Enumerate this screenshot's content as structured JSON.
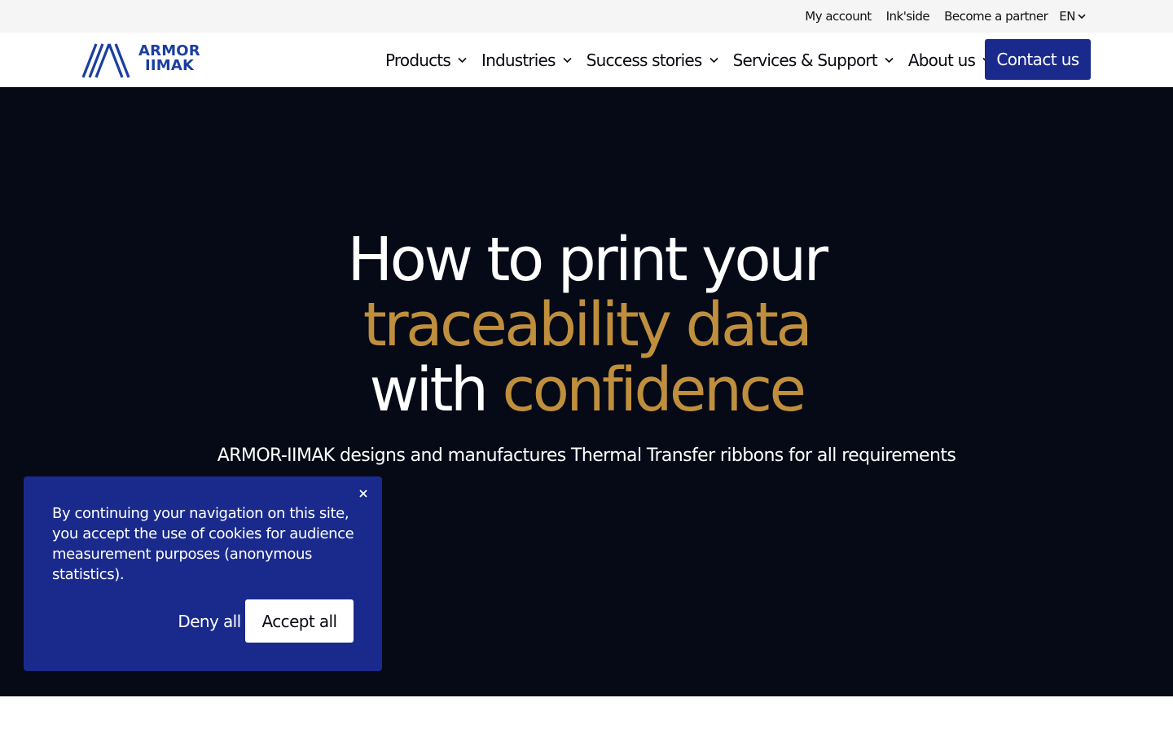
{
  "topbar": {
    "links": [
      "My account",
      "Ink'side",
      "Become a partner"
    ],
    "language": "EN"
  },
  "brand": {
    "line1": "ARMOR",
    "line2": "IIMAK",
    "color": "#1b3fa0"
  },
  "nav": {
    "items": [
      {
        "label": "Products"
      },
      {
        "label": "Industries"
      },
      {
        "label": "Success stories"
      },
      {
        "label": "Services & Support"
      },
      {
        "label": "About us"
      }
    ],
    "contact_label": "Contact us",
    "accent": "#1a2a8c"
  },
  "hero": {
    "line1": "How to print your",
    "line2_gold": "traceability data",
    "line3_white": "with",
    "line3_gold": "confidence",
    "subtitle": "ARMOR-IIMAK designs and manufactures Thermal Transfer ribbons for all requirements",
    "background": "#060a17",
    "gold": "#bf8f3d"
  },
  "cookie": {
    "text": "By continuing your navigation on this site, you accept the use of cookies for audience measurement purposes (anonymous statistics).",
    "deny_label": "Deny all",
    "accept_label": "Accept all",
    "close_icon": "close-icon"
  }
}
